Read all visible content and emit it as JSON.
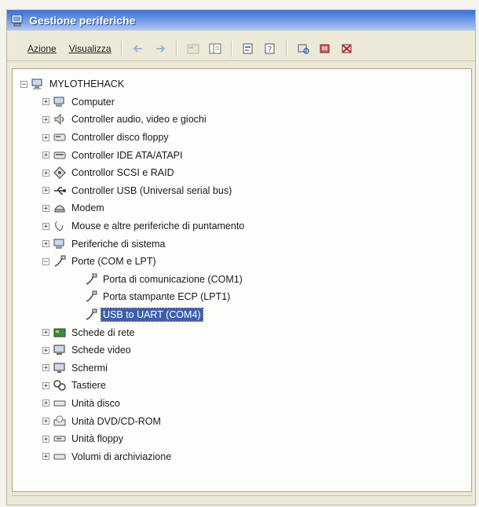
{
  "window": {
    "title": "Gestione periferiche"
  },
  "toolbar": {
    "menu": [
      {
        "label": "Azione"
      },
      {
        "label": "Visualizza"
      }
    ],
    "buttons": [
      "back-icon",
      "forward-icon",
      "view-icon",
      "properties-pane-icon",
      "properties-icon",
      "help-icon",
      "scan-hardware-icon",
      "update-driver-icon",
      "disable-device-icon"
    ]
  },
  "tree": {
    "root": "MYLOTHEHACK",
    "categories": [
      {
        "label": "Computer",
        "icon": "computer-icon"
      },
      {
        "label": "Controller audio, video e giochi",
        "icon": "audio-icon"
      },
      {
        "label": "Controller disco floppy",
        "icon": "floppy-controller-icon"
      },
      {
        "label": "Controller IDE ATA/ATAPI",
        "icon": "ide-controller-icon"
      },
      {
        "label": "Controllor SCSI e RAID",
        "icon": "scsi-icon"
      },
      {
        "label": "Controller USB (Universal serial bus)",
        "icon": "usb-icon"
      },
      {
        "label": "Modem",
        "icon": "modem-icon"
      },
      {
        "label": "Mouse e altre periferiche di puntamento",
        "icon": "mouse-icon"
      },
      {
        "label": "Periferiche di sistema",
        "icon": "system-device-icon"
      },
      {
        "label": "Porte (COM e LPT)",
        "icon": "port-icon",
        "expanded": true,
        "children": [
          {
            "label": "Porta di comunicazione (COM1)",
            "icon": "port-icon"
          },
          {
            "label": "Porta stampante ECP (LPT1)",
            "icon": "port-icon"
          },
          {
            "label": "USB to UART (COM4)",
            "icon": "port-icon",
            "selected": true
          }
        ]
      },
      {
        "label": "Schede di rete",
        "icon": "network-card-icon"
      },
      {
        "label": "Schede video",
        "icon": "video-card-icon"
      },
      {
        "label": "Schermi",
        "icon": "monitor-icon"
      },
      {
        "label": "Tastiere",
        "icon": "keyboard-icon"
      },
      {
        "label": "Unità disco",
        "icon": "disk-drive-icon"
      },
      {
        "label": "Unità DVD/CD-ROM",
        "icon": "dvd-icon"
      },
      {
        "label": "Unità floppy",
        "icon": "floppy-drive-icon"
      },
      {
        "label": "Volumi di archiviazione",
        "icon": "storage-volume-icon"
      }
    ]
  },
  "colors": {
    "titlebar": "#3a6fd8",
    "selection": "#3d5fb0",
    "window": "#ece9d8"
  }
}
